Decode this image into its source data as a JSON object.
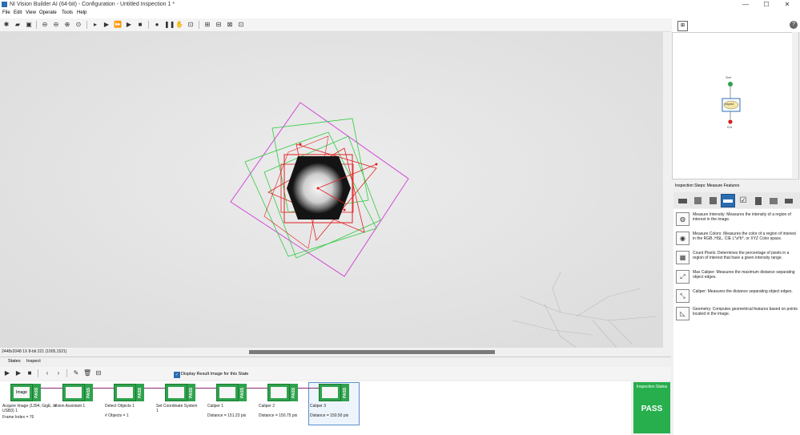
{
  "window": {
    "title": "NI Vision Builder AI (64-bit) - Configuration - Untitled Inspection 1 *",
    "minimize": "—",
    "maximize": "☐",
    "close": "✕"
  },
  "menu": [
    "File",
    "Edit",
    "View",
    "Operate",
    "Tools",
    "Help"
  ],
  "viewer": {
    "status": "2448x2048 1X 8-bit 221    (1005,1521)"
  },
  "right_panel": {
    "steps_header": "Inspection Steps: Measure Features",
    "help_icon": "?",
    "flow": {
      "start": "Start",
      "state": "Inspect",
      "end": "End"
    },
    "steps": [
      {
        "icon": "measure-intensity-icon",
        "text": "Measure Intensity: Measures the intensity of a region of interest in the image."
      },
      {
        "icon": "measure-colors-icon",
        "text": "Measure Colors: Measures the color of a region of interest in the RGB, HSL, CIE L*a*b*, or XYZ Color space."
      },
      {
        "icon": "count-pixels-icon",
        "text": "Count Pixels: Determines the percentage of pixels in a region of interest that have a given intensity range."
      },
      {
        "icon": "max-caliper-icon",
        "text": "Max Caliper: Measures the maximum distance separating object edges."
      },
      {
        "icon": "caliper-icon",
        "text": "Caliper: Measures the distance separating object edges."
      },
      {
        "icon": "geometry-icon",
        "text": "Geometry: Computes geometrical features based on points located in the image."
      }
    ]
  },
  "tabs": [
    "States",
    "Inspect"
  ],
  "display_result": {
    "checked": true,
    "label": "Display Result Image for this State"
  },
  "steps_strip": [
    {
      "name": "Acquire Image (1394, GigE, or USB3) 1",
      "result": "Frame Index = 76",
      "badge": "PASS",
      "thumb": "Image"
    },
    {
      "name": "Vision Assistant 1",
      "result": "",
      "badge": "PASS",
      "thumb": ""
    },
    {
      "name": "Detect Objects 1",
      "result": "# Objects = 1",
      "badge": "PASS",
      "thumb": ""
    },
    {
      "name": "Set Coordinate System",
      "result": "1",
      "badge": "PASS",
      "thumb": ""
    },
    {
      "name": "Caliper 1",
      "result": "Distance = 151.23 pix",
      "badge": "PASS",
      "thumb": ""
    },
    {
      "name": "Caliper 2",
      "result": "Distance = 150.75 pix",
      "badge": "PASS",
      "thumb": ""
    },
    {
      "name": "Caliper 3",
      "result": "Distance = 150.50 pix",
      "badge": "PASS",
      "thumb": ""
    }
  ],
  "inspection_status": {
    "title": "Inspection Status",
    "value": "PASS"
  },
  "colors": {
    "pass_green": "#27ae4d",
    "selection_blue": "#2b6cb0",
    "overlay_red": "#e02020",
    "overlay_green": "#2ecc40",
    "overlay_magenta": "#d24ad8"
  }
}
